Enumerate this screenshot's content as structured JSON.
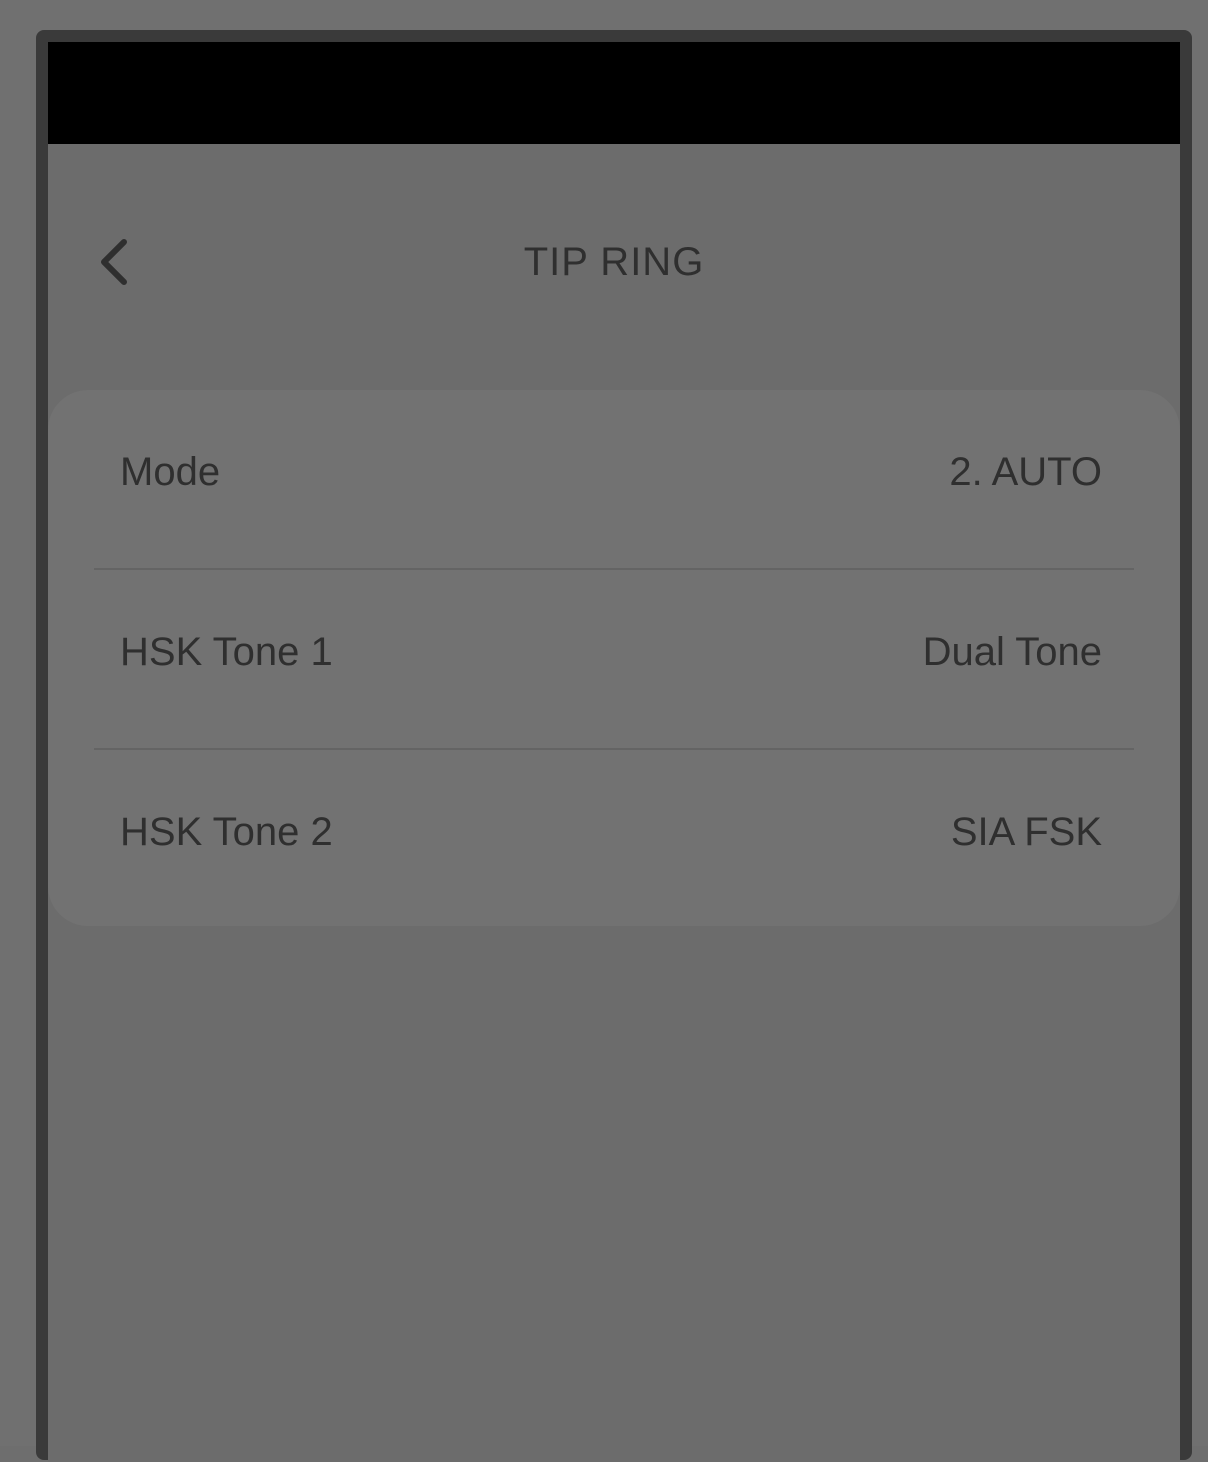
{
  "header": {
    "title": "TIP RING",
    "back_icon": "chevron-left-icon"
  },
  "settings": {
    "rows": [
      {
        "label": "Mode",
        "value": "2. AUTO"
      },
      {
        "label": "HSK Tone 1",
        "value": "Dual Tone"
      },
      {
        "label": "HSK Tone 2",
        "value": "SIA FSK"
      }
    ]
  },
  "colors": {
    "overlay_background": "#6e6e6e",
    "status_bar": "#000000",
    "text": "#2f2f2f",
    "card": "#727272",
    "divider": "#646464"
  }
}
